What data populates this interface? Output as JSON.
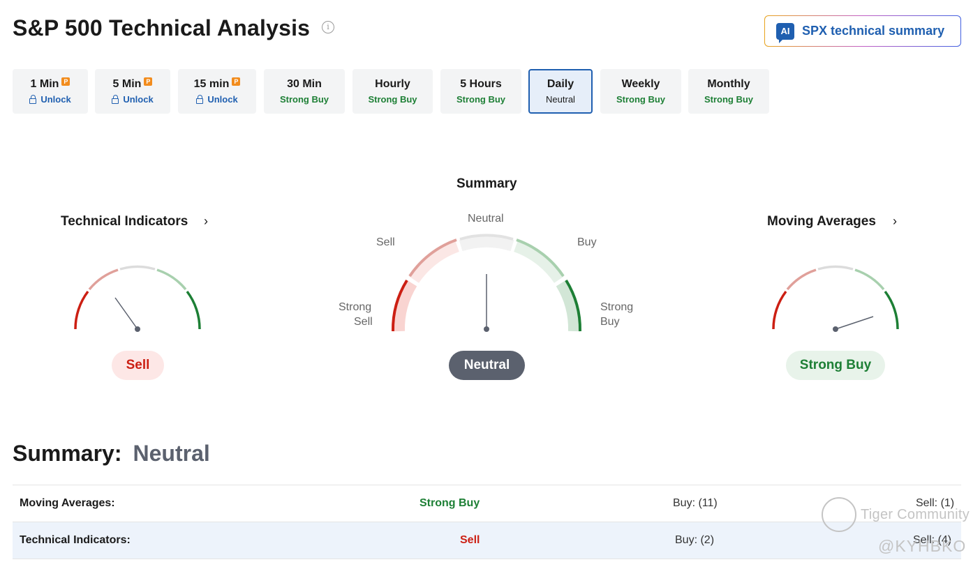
{
  "header": {
    "title": "S&P 500 Technical Analysis",
    "info_icon": "info-circle-icon",
    "ai_button": {
      "badge": "AI",
      "label": "SPX technical summary"
    }
  },
  "tabs": [
    {
      "name": "1 Min",
      "value": "Unlock",
      "locked": true,
      "pro": "P"
    },
    {
      "name": "5 Min",
      "value": "Unlock",
      "locked": true,
      "pro": "P"
    },
    {
      "name": "15 min",
      "value": "Unlock",
      "locked": true,
      "pro": "P"
    },
    {
      "name": "30 Min",
      "value": "Strong Buy"
    },
    {
      "name": "Hourly",
      "value": "Strong Buy"
    },
    {
      "name": "5 Hours",
      "value": "Strong Buy"
    },
    {
      "name": "Daily",
      "value": "Neutral",
      "active": true
    },
    {
      "name": "Weekly",
      "value": "Strong Buy"
    },
    {
      "name": "Monthly",
      "value": "Strong Buy"
    }
  ],
  "gauges": {
    "technical": {
      "title": "Technical Indicators",
      "chevron": "›",
      "result": "Sell"
    },
    "summary": {
      "title": "Summary",
      "labels": {
        "neutral": "Neutral",
        "sell": "Sell",
        "buy": "Buy",
        "strong_sell_1": "Strong",
        "strong_sell_2": "Sell",
        "strong_buy_1": "Strong",
        "strong_buy_2": "Buy"
      },
      "result": "Neutral"
    },
    "moving": {
      "title": "Moving Averages",
      "chevron": "›",
      "result": "Strong Buy"
    }
  },
  "summary_section": {
    "heading": "Summary:",
    "value": "Neutral",
    "rows": [
      {
        "label": "Moving Averages:",
        "signal": "Strong Buy",
        "buy": "Buy: (11)",
        "sell": "Sell: (1)"
      },
      {
        "label": "Technical Indicators:",
        "signal": "Sell",
        "buy": "Buy: (2)",
        "sell": "Sell: (4)"
      }
    ]
  },
  "watermark": {
    "brand": "Tiger Community",
    "handle": "@KYHBKO"
  },
  "colors": {
    "brand_blue": "#1f5fb0",
    "strong_buy": "#1d7f35",
    "sell": "#cc1f13",
    "neutral_pill": "#5b616e",
    "pro_badge": "#f28c1d"
  }
}
